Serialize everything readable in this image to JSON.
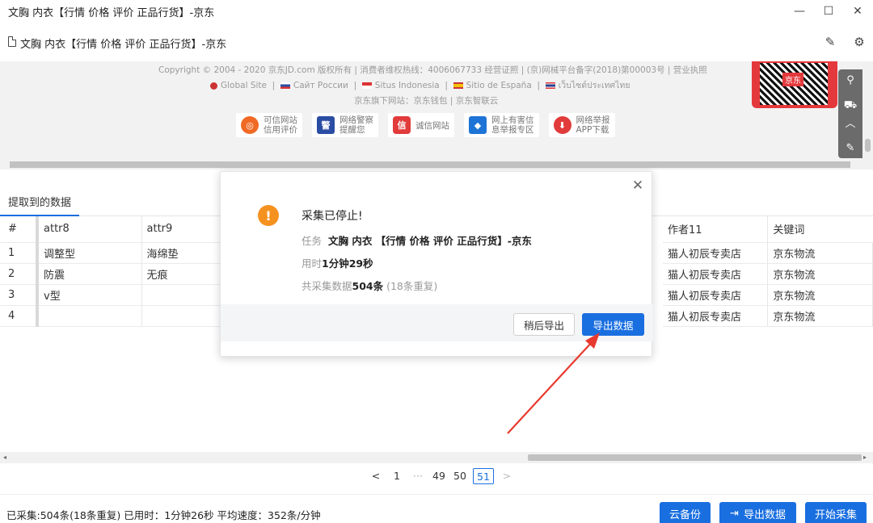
{
  "window": {
    "title": "文胸 内衣【行情 价格 评价 正品行货】-京东"
  },
  "address": {
    "url": "文胸 内衣【行情 价格 评价 正品行货】-京东"
  },
  "footer_site": {
    "copyright": "Copyright © 2004 - 2020 京东JD.com 版权所有 | 消费者维权热线：4006067733   经营证照 | (京)网械平台备字(2018)第00003号 | 营业执照",
    "intl": [
      "Global Site",
      "Сайт России",
      "Situs Indonesia",
      "Sitio de España",
      "เว็บไซต์ประเทศไทย"
    ],
    "sub": "京东旗下网站：京东钱包 | 京东智联云",
    "badges": [
      {
        "label1": "可信网站",
        "label2": "信用评价",
        "color": "#f06a25"
      },
      {
        "label1": "网络警察",
        "label2": "提醒您",
        "color": "#2a4da3"
      },
      {
        "label1": "诚信网站",
        "label2": "",
        "color": "#e23b3b"
      },
      {
        "label1": "网上有害信",
        "label2": "息举报专区",
        "color": "#1e73d6"
      },
      {
        "label1": "网络举报",
        "label2": "APP下载",
        "color": "#e13b3b"
      }
    ],
    "qr_badge": "京东"
  },
  "panel": {
    "tab": "提取到的数据",
    "left_headers": [
      "#",
      "attr8",
      "attr9"
    ],
    "left_rows": [
      [
        "1",
        "调整型",
        "海绵垫"
      ],
      [
        "2",
        "防震",
        "无痕"
      ],
      [
        "3",
        "v型",
        ""
      ],
      [
        "4",
        "",
        ""
      ]
    ],
    "right_headers": [
      "作者11",
      "关键词"
    ],
    "right_rows": [
      [
        "猫人初辰专卖店",
        "京东物流"
      ],
      [
        "猫人初辰专卖店",
        "京东物流"
      ],
      [
        "猫人初辰专卖店",
        "京东物流"
      ],
      [
        "猫人初辰专卖店",
        "京东物流"
      ]
    ]
  },
  "modal": {
    "title": "采集已停止!",
    "task_label": "任务",
    "task_value": "文胸 内衣 【行情 价格 评价 正品行货】-京东",
    "time_label": "用时",
    "time_value": "1分钟29秒",
    "total_label": "共采集数据",
    "total_value": "504条",
    "dup": "(18条重复)",
    "later_button": "稍后导出",
    "export_button": "导出数据"
  },
  "pager": {
    "prev": "<",
    "p1": "1",
    "ellipsis": "···",
    "p49": "49",
    "p50": "50",
    "current": "51",
    "next": ">"
  },
  "status": {
    "text": "已采集:504条(18条重复) 已用时：1分钟26秒 平均速度：352条/分钟",
    "cloud_button": "云备份",
    "export_button": "导出数据",
    "start_button": "开始采集"
  },
  "colors": {
    "accent": "#1a6fe0",
    "warning": "#f5921f",
    "arrow": "#e8392f"
  }
}
